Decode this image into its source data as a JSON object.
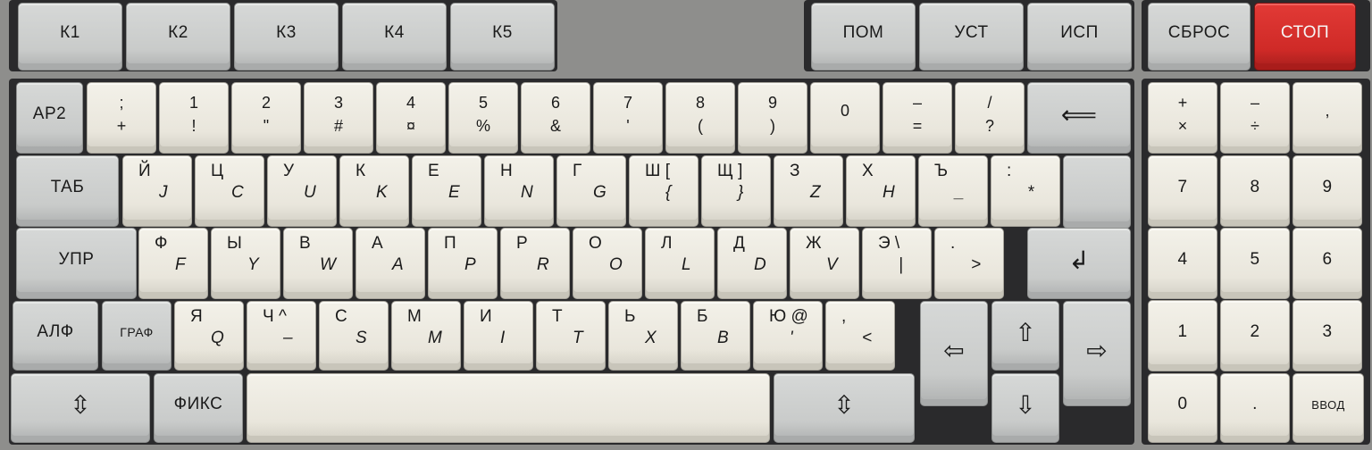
{
  "keyboard": {
    "function_row": [
      "К1",
      "К2",
      "К3",
      "К4",
      "К5"
    ],
    "system_keys": [
      "ПОМ",
      "УСТ",
      "ИСП"
    ],
    "reset_keys": [
      "СБРОС",
      "СТОП"
    ],
    "row1": {
      "ar2": "АР2",
      "keys": [
        {
          "top": ";",
          "bottom": "+"
        },
        {
          "top": "1",
          "bottom": "!"
        },
        {
          "top": "2",
          "bottom": "\""
        },
        {
          "top": "3",
          "bottom": "#"
        },
        {
          "top": "4",
          "bottom": "¤"
        },
        {
          "top": "5",
          "bottom": "%"
        },
        {
          "top": "6",
          "bottom": "&"
        },
        {
          "top": "7",
          "bottom": "'"
        },
        {
          "top": "8",
          "bottom": "("
        },
        {
          "top": "9",
          "bottom": ")"
        },
        {
          "top": "0",
          "bottom": ""
        },
        {
          "top": "–",
          "bottom": "="
        },
        {
          "top": "/",
          "bottom": "?"
        }
      ],
      "backspace_icon": "left-arrow-icon"
    },
    "row2": {
      "tab": "ТАБ",
      "keys": [
        {
          "cy": "Й",
          "la": "J"
        },
        {
          "cy": "Ц",
          "la": "C"
        },
        {
          "cy": "У",
          "la": "U"
        },
        {
          "cy": "К",
          "la": "K"
        },
        {
          "cy": "Е",
          "la": "E"
        },
        {
          "cy": "Н",
          "la": "N"
        },
        {
          "cy": "Г",
          "la": "G"
        },
        {
          "cy": "Ш [",
          "la": "{"
        },
        {
          "cy": "Щ ]",
          "la": "}"
        },
        {
          "cy": "З",
          "la": "Z"
        },
        {
          "cy": "Х",
          "la": "H"
        },
        {
          "cy": "Ъ",
          "la": "_"
        },
        {
          "cy": ":",
          "la": "*"
        }
      ]
    },
    "row3": {
      "upr": "УПР",
      "keys": [
        {
          "cy": "Ф",
          "la": "F"
        },
        {
          "cy": "Ы",
          "la": "Y"
        },
        {
          "cy": "В",
          "la": "W"
        },
        {
          "cy": "А",
          "la": "A"
        },
        {
          "cy": "П",
          "la": "P"
        },
        {
          "cy": "Р",
          "la": "R"
        },
        {
          "cy": "О",
          "la": "O"
        },
        {
          "cy": "Л",
          "la": "L"
        },
        {
          "cy": "Д",
          "la": "D"
        },
        {
          "cy": "Ж",
          "la": "V"
        },
        {
          "cy": "Э \\",
          "la": "|"
        },
        {
          "cy": ".",
          "la": ">"
        }
      ],
      "enter_icon": "enter-arrow-icon"
    },
    "row4": {
      "alf": "АЛФ",
      "graf": "ГРАФ",
      "keys": [
        {
          "cy": "Я",
          "la": "Q"
        },
        {
          "cy": "Ч ^",
          "la": "–"
        },
        {
          "cy": "С",
          "la": "S"
        },
        {
          "cy": "М",
          "la": "M"
        },
        {
          "cy": "И",
          "la": "I"
        },
        {
          "cy": "Т",
          "la": "T"
        },
        {
          "cy": "Ь",
          "la": "X"
        },
        {
          "cy": "Б",
          "la": "B"
        },
        {
          "cy": "Ю @",
          "la": "'"
        },
        {
          "cy": ",",
          "la": "<"
        }
      ]
    },
    "row5": {
      "fix": "ФИКС"
    },
    "numpad": {
      "top": [
        {
          "top": "+",
          "bottom": "×"
        },
        {
          "top": "–",
          "bottom": "÷"
        },
        {
          "top": ",",
          "bottom": ""
        }
      ],
      "digits": [
        "7",
        "8",
        "9",
        "4",
        "5",
        "6",
        "1",
        "2",
        "3",
        "0",
        "."
      ],
      "enter": "ВВОД"
    },
    "arrows": {
      "left": "⇦",
      "right": "⇨",
      "up": "⇧",
      "down": "⇩",
      "updown": "⇳"
    }
  }
}
